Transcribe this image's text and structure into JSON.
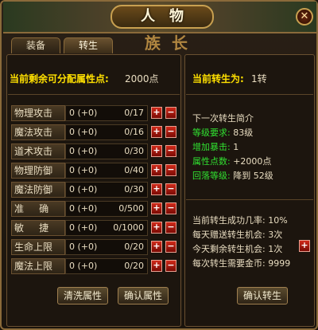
{
  "window": {
    "title": "人物",
    "close_glyph": "✕",
    "decor_text": "族长"
  },
  "tabs": [
    {
      "label": "装备",
      "active": false
    },
    {
      "label": "转生",
      "active": true
    }
  ],
  "left": {
    "points_label": "当前剩余可分配属性点:",
    "points_value": "2000点",
    "attributes": [
      {
        "name": "物理攻击",
        "base": "0 (+0)",
        "ratio": "0/17"
      },
      {
        "name": "魔法攻击",
        "base": "0 (+0)",
        "ratio": "0/16"
      },
      {
        "name": "道术攻击",
        "base": "0 (+0)",
        "ratio": "0/30"
      },
      {
        "name": "物理防御",
        "base": "0 (+0)",
        "ratio": "0/40"
      },
      {
        "name": "魔法防御",
        "base": "0 (+0)",
        "ratio": "0/30"
      },
      {
        "name": "准     确",
        "base": "0 (+0)",
        "ratio": "0/500"
      },
      {
        "name": "敏     捷",
        "base": "0 (+0)",
        "ratio": "0/1000"
      },
      {
        "name": "生命上限",
        "base": "0 (+0)",
        "ratio": "0/20"
      },
      {
        "name": "魔法上限",
        "base": "0 (+0)",
        "ratio": "0/20"
      }
    ],
    "plus_label": "+",
    "minus_label": "−",
    "wash_button": "清洗属性",
    "confirm_button": "确认属性"
  },
  "right": {
    "rebirth_label": "当前转生为:",
    "rebirth_value": "1转",
    "next_intro": "下一次转生简介",
    "level_req_label": "等级要求:",
    "level_req_value": "83级",
    "burst_label": "增加暴击:",
    "burst_value": "1",
    "attr_pts_label": "属性点数:",
    "attr_pts_value": "+2000点",
    "drop_label": "回落等级:",
    "drop_value": "降到 52级",
    "success_rate": "当前转生成功几率: 10%",
    "daily_gift": "每天赠送转生机会: 3次",
    "remaining_today": "今天剩余转生机会: 1次",
    "gold_needed": "每次转生需要金币: 9999",
    "add_chance_label": "+",
    "confirm_button": "确认转生"
  },
  "colors": {
    "accent_yellow": "#ffe000",
    "accent_green": "#30e030",
    "button_red": "#c02010"
  }
}
